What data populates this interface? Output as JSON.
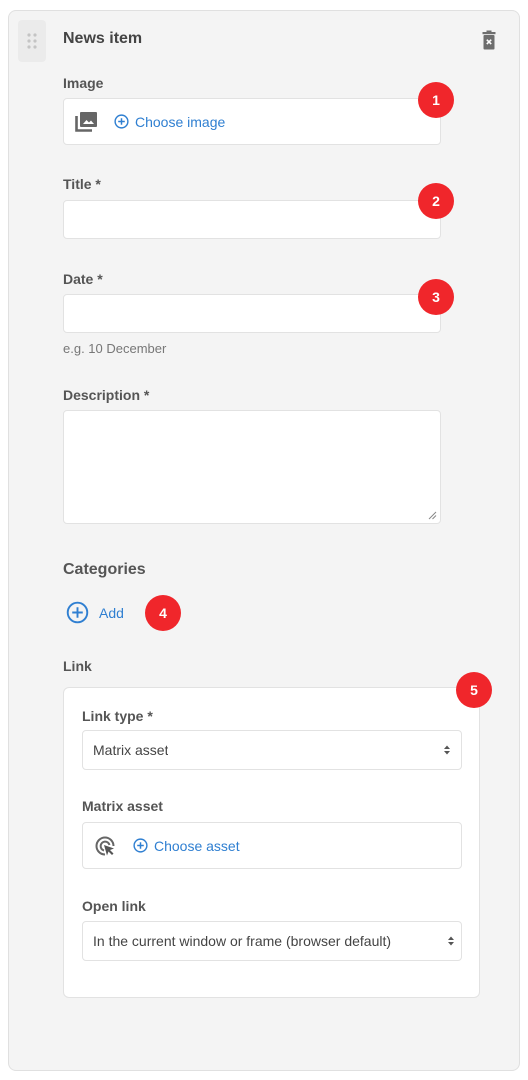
{
  "panel": {
    "title": "News item",
    "icons": {
      "drag": "drag-handle-icon",
      "delete": "trash-icon"
    }
  },
  "fields": {
    "image": {
      "label": "Image",
      "icon": "image-gallery-icon",
      "action_label": "Choose image",
      "action_icon": "plus-circle-icon"
    },
    "title": {
      "label": "Title *",
      "value": ""
    },
    "date": {
      "label": "Date *",
      "value": "",
      "hint": "e.g. 10 December"
    },
    "description": {
      "label": "Description *",
      "value": ""
    }
  },
  "categories": {
    "title": "Categories",
    "add_label": "Add",
    "add_icon": "plus-circle-icon"
  },
  "link": {
    "title": "Link",
    "link_type": {
      "label": "Link type *",
      "selected": "Matrix asset"
    },
    "matrix_asset": {
      "label": "Matrix asset",
      "icon": "asset-cursor-icon",
      "action_label": "Choose asset",
      "action_icon": "plus-circle-icon"
    },
    "open_link": {
      "label": "Open link",
      "selected": "In the current window or frame (browser default)"
    }
  },
  "badges": [
    "1",
    "2",
    "3",
    "4",
    "5"
  ],
  "colors": {
    "accent": "#2f7fd1",
    "badge": "#f0262b",
    "panel_bg": "#f4f4f4"
  }
}
